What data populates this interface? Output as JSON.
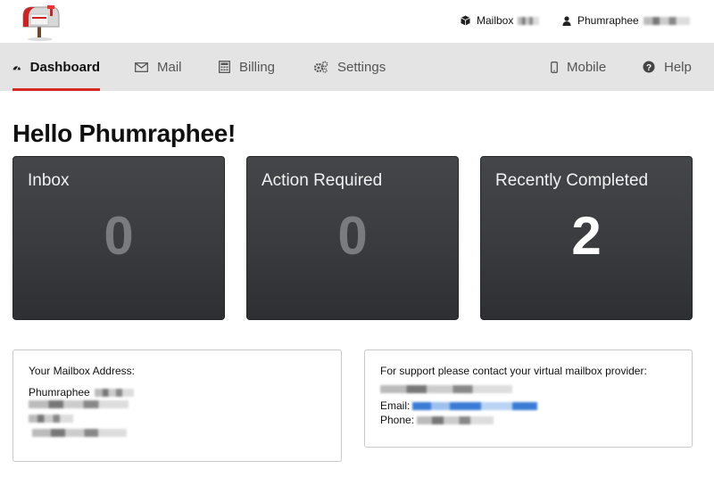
{
  "header": {
    "logo_icon": "mailbox-logo-icon",
    "mailbox_label": "Mailbox",
    "user_name": "Phumraphee"
  },
  "nav": {
    "items": [
      {
        "label": "Dashboard",
        "icon": "speedometer-icon",
        "active": true
      },
      {
        "label": "Mail",
        "icon": "envelope-icon"
      },
      {
        "label": "Billing",
        "icon": "calculator-icon"
      },
      {
        "label": "Settings",
        "icon": "gears-icon"
      },
      {
        "label": "Mobile",
        "icon": "mobile-phone-icon"
      },
      {
        "label": "Help",
        "icon": "question-circle-icon"
      }
    ],
    "active_color": "#d42a20"
  },
  "greeting": "Hello Phumraphee!",
  "cards": [
    {
      "title": "Inbox",
      "count": "0"
    },
    {
      "title": "Action Required",
      "count": "0"
    },
    {
      "title": "Recently Completed",
      "count": "2"
    }
  ],
  "address_box": {
    "heading": "Your Mailbox Address:",
    "name": "Phumraphee"
  },
  "support_box": {
    "heading": "For support please contact your virtual mailbox provider:",
    "email_label": "Email:",
    "phone_label": "Phone:"
  }
}
